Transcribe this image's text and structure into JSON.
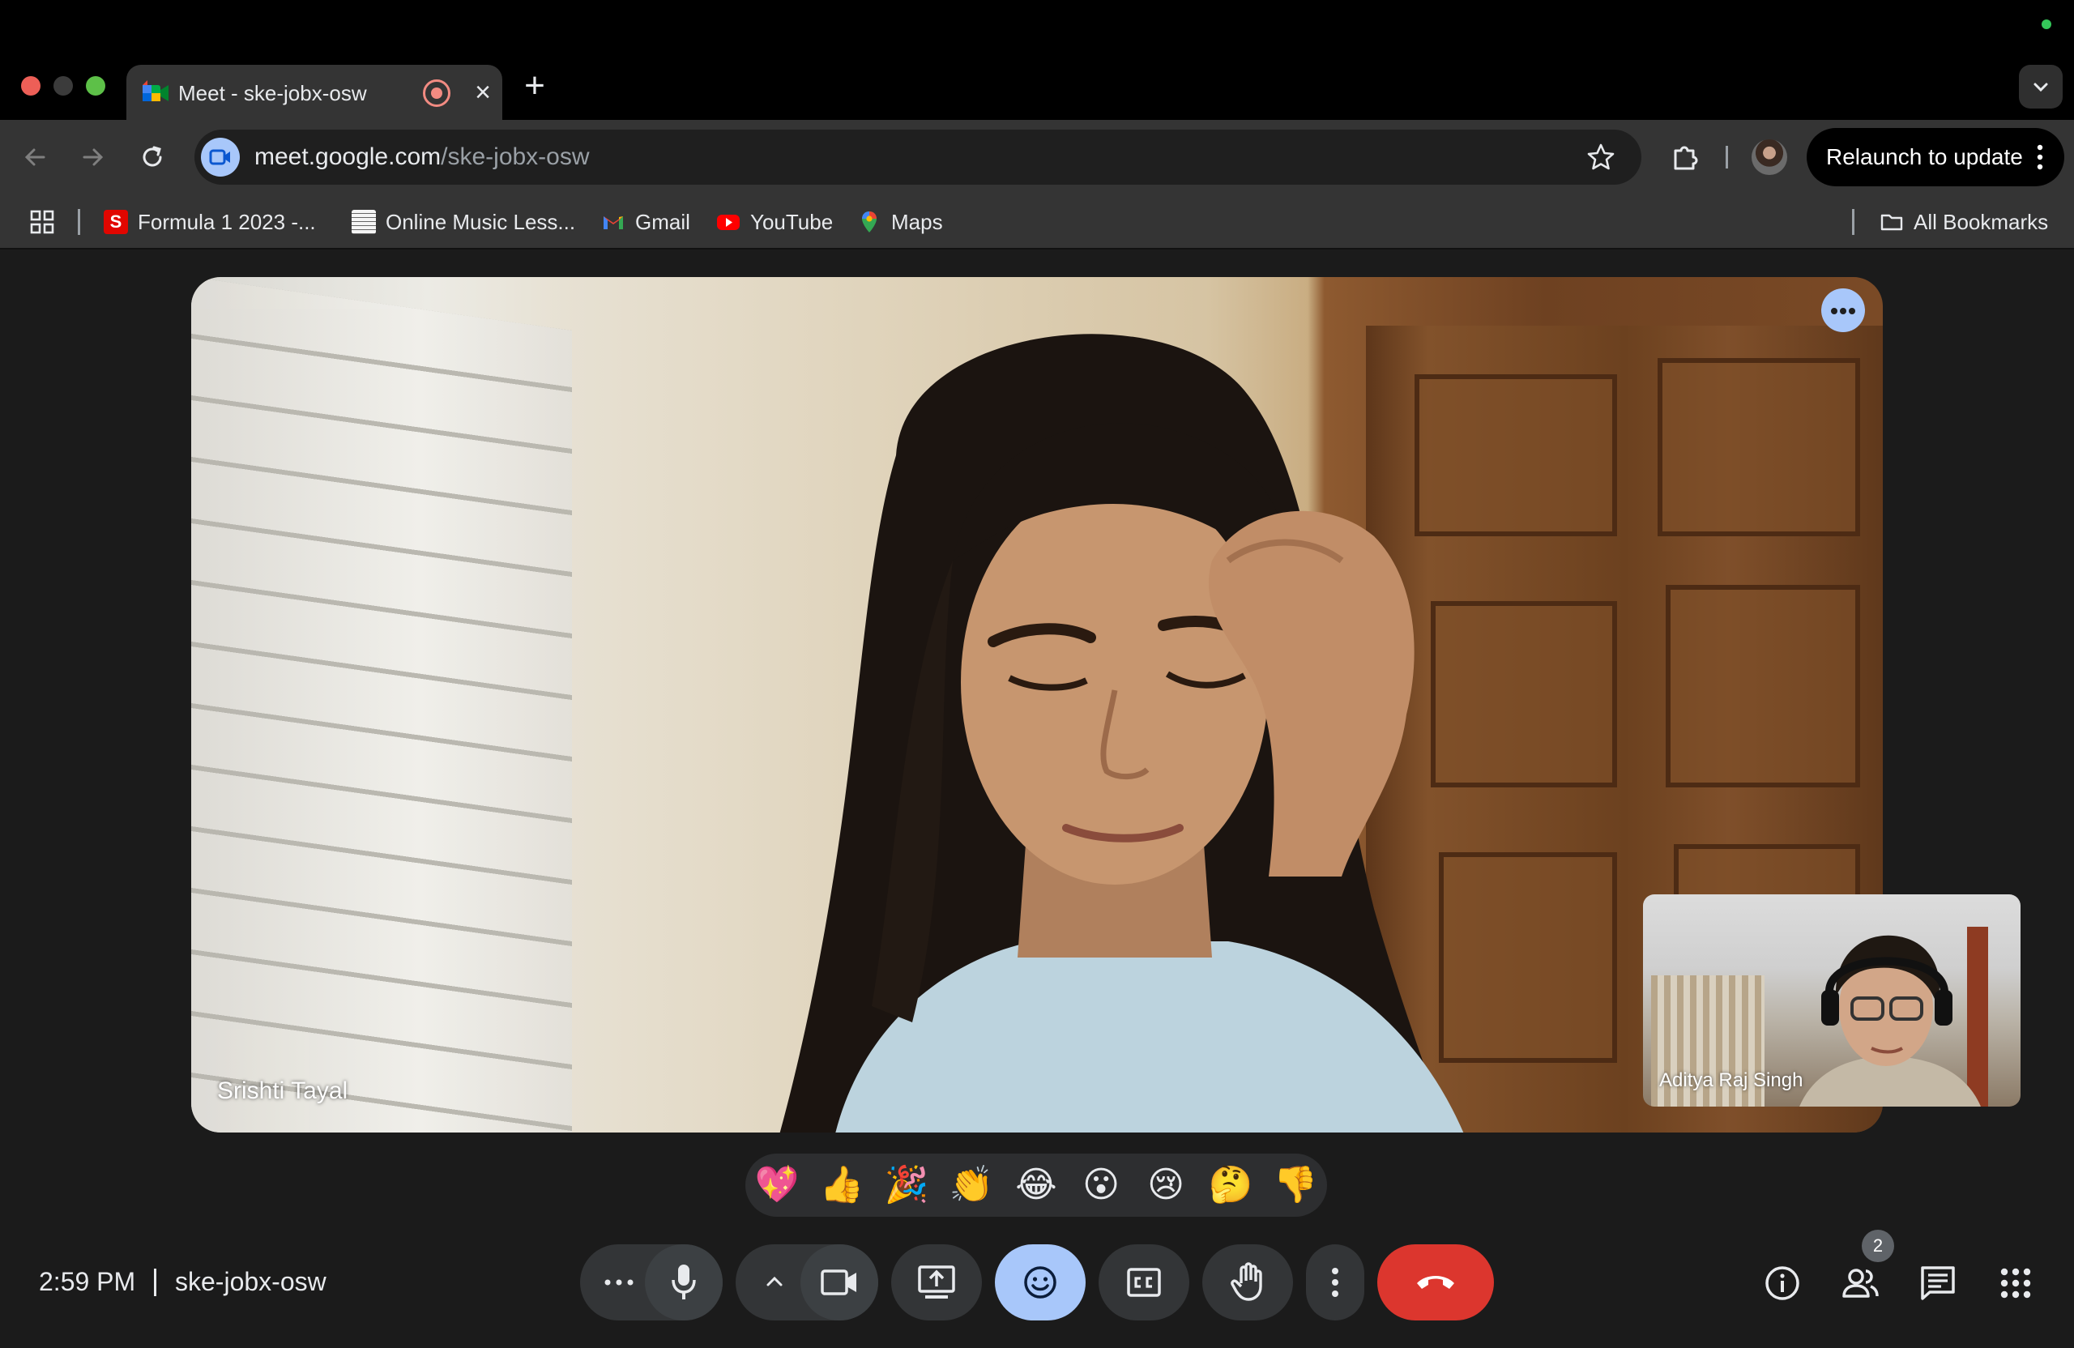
{
  "browser": {
    "tab": {
      "title": "Meet - ske-jobx-osw"
    },
    "address": {
      "host": "meet.google.com",
      "path": "/ske-jobx-osw"
    },
    "relaunch_label": "Relaunch to update",
    "bookmarks": [
      {
        "label": "Formula 1 2023 -...",
        "icon": "formula-s-icon"
      },
      {
        "label": "Online Music Less...",
        "icon": "music-sheet-icon"
      },
      {
        "label": "Gmail",
        "icon": "gmail-icon"
      },
      {
        "label": "YouTube",
        "icon": "youtube-icon"
      },
      {
        "label": "Maps",
        "icon": "maps-pin-icon"
      }
    ],
    "all_bookmarks_label": "All Bookmarks"
  },
  "meet": {
    "main_participant": "Srishti Tayal",
    "self_participant": "Aditya Raj Singh",
    "reactions": [
      "💖",
      "👍",
      "🎉",
      "👏",
      "😂",
      "😮",
      "😢",
      "🤔",
      "👎"
    ],
    "time": "2:59 PM",
    "code": "ske-jobx-osw",
    "participant_count": "2"
  },
  "colors": {
    "accent": "#a8c7fa",
    "end_call": "#dc362e",
    "control_bg": "#333537",
    "background": "#1b1b1b"
  }
}
